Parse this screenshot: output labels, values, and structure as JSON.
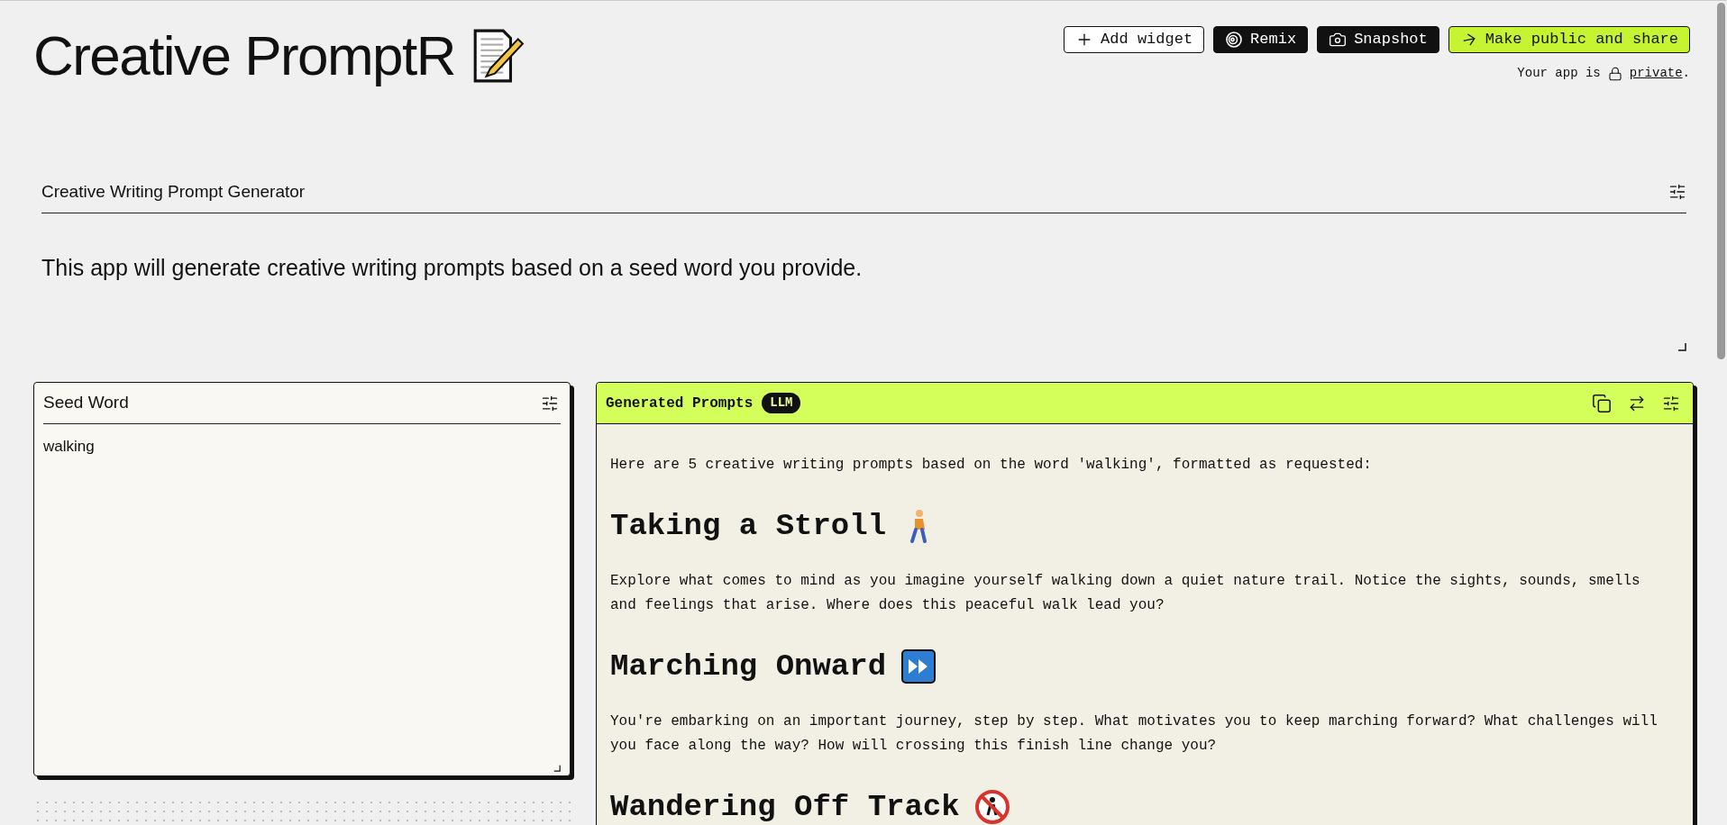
{
  "app": {
    "title": "Creative PromptR"
  },
  "toolbar": {
    "buttons": [
      {
        "kind": "add",
        "label": "Add widget"
      },
      {
        "kind": "remix",
        "label": "Remix"
      },
      {
        "kind": "snapshot",
        "label": "Snapshot"
      },
      {
        "kind": "share",
        "label": "Make public and share"
      }
    ],
    "visibility": {
      "prefix": "Your app is",
      "link": "private",
      "suffix": "."
    }
  },
  "description": {
    "title": "Creative Writing Prompt Generator",
    "text": "This app will generate creative writing prompts based on a seed word you provide."
  },
  "seed_panel": {
    "title": "Seed Word",
    "value": "walking"
  },
  "output_panel": {
    "title": "Generated Prompts",
    "badge": "LLM",
    "intro": "Here are 5 creative writing prompts based on the word 'walking', formatted as requested:",
    "sections": [
      {
        "title": "Taking a Stroll",
        "kind": "walking",
        "body": "Explore what comes to mind as you imagine yourself walking down a quiet nature trail. Notice the sights, sounds, smells and feelings that arise. Where does this peaceful walk lead you?"
      },
      {
        "title": "Marching Onward",
        "kind": "fast-forward",
        "body": "You're embarking on an important journey, step by step. What motivates you to keep marching forward? What challenges will you face along the way? How will crossing this finish line change you?"
      },
      {
        "title": "Wandering Off Track",
        "kind": "no-pedestrians"
      }
    ]
  }
}
